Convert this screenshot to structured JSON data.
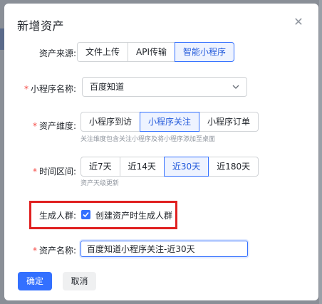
{
  "dialog": {
    "title": "新增资产",
    "close_icon": "close-icon"
  },
  "source": {
    "label": "资产来源:",
    "options": [
      "文件上传",
      "API传输",
      "智能小程序"
    ],
    "selected": "智能小程序"
  },
  "miniprogram_name": {
    "required_mark": "*",
    "label": "小程序名称:",
    "value": "百度知道",
    "icon": "chevron-down-icon"
  },
  "dimension": {
    "required_mark": "*",
    "label": "资产维度:",
    "options": [
      "小程序到访",
      "小程序关注",
      "小程序订单"
    ],
    "selected": "小程序关注",
    "hint": "关注维度包含关注小程序及将小程序添加至桌面"
  },
  "time_range": {
    "required_mark": "*",
    "label": "时间区间:",
    "options": [
      "近7天",
      "近14天",
      "近30天",
      "近180天"
    ],
    "selected": "近30天",
    "hint": "资产天级更新"
  },
  "generate_audience": {
    "label": "生成人群:",
    "checkbox_label": "创建资产时生成人群",
    "checked": true
  },
  "asset_name": {
    "required_mark": "*",
    "label": "资产名称:",
    "value": "百度知道小程序关注-近30天"
  },
  "footer": {
    "confirm_label": "确定",
    "cancel_label": "取消"
  },
  "colors": {
    "accent": "#3370ff",
    "highlight": "#e02020",
    "required": "#f54a45"
  }
}
